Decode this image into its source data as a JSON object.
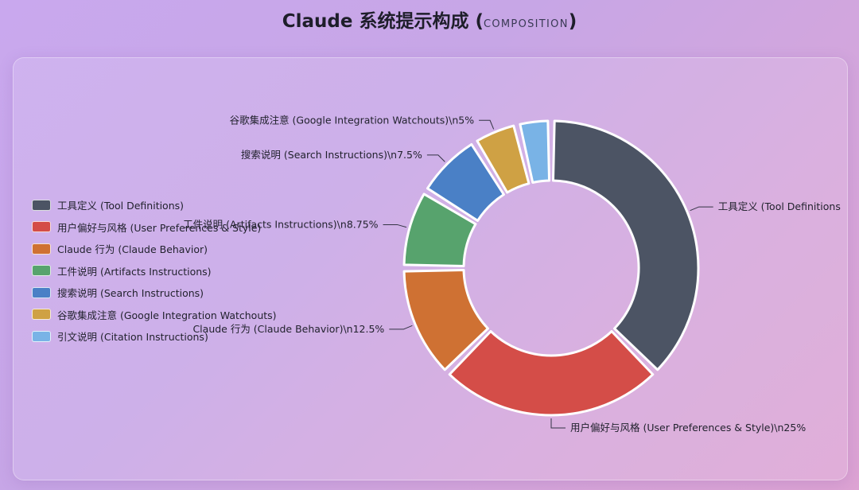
{
  "title": {
    "main": "Claude 系统提示构成 (",
    "sub": "COMPOSITION",
    "close": ")"
  },
  "chart_data": {
    "type": "pie",
    "donut": true,
    "categories": [
      "工具定义 (Tool Definitions)",
      "用户偏好与风格 (User Preferences & Style)",
      "Claude 行为 (Claude Behavior)",
      "工件说明 (Artifacts Instructions)",
      "搜索说明 (Search Instructions)",
      "谷歌集成注意 (Google Integration Watchouts)",
      "引文说明 (Citation Instructions)"
    ],
    "values": [
      37.5,
      25,
      12.5,
      8.75,
      7.5,
      5,
      3.75
    ],
    "colors": [
      "#4c5464",
      "#d44d48",
      "#cf7133",
      "#57a36d",
      "#4a80c6",
      "#cfa144",
      "#79b3e6"
    ],
    "slice_labels": [
      "工具定义 (Tool Definitions",
      "用户偏好与风格 (User Preferences & Style)\\n25%",
      "Claude 行为 (Claude Behavior)\\n12.5%",
      "工件说明 (Artifacts Instructions)\\n8.75%",
      "搜索说明 (Search Instructions)\\n7.5%",
      "谷歌集成注意 (Google Integration Watchouts)\\n5%",
      ""
    ],
    "legend_position": "left"
  }
}
